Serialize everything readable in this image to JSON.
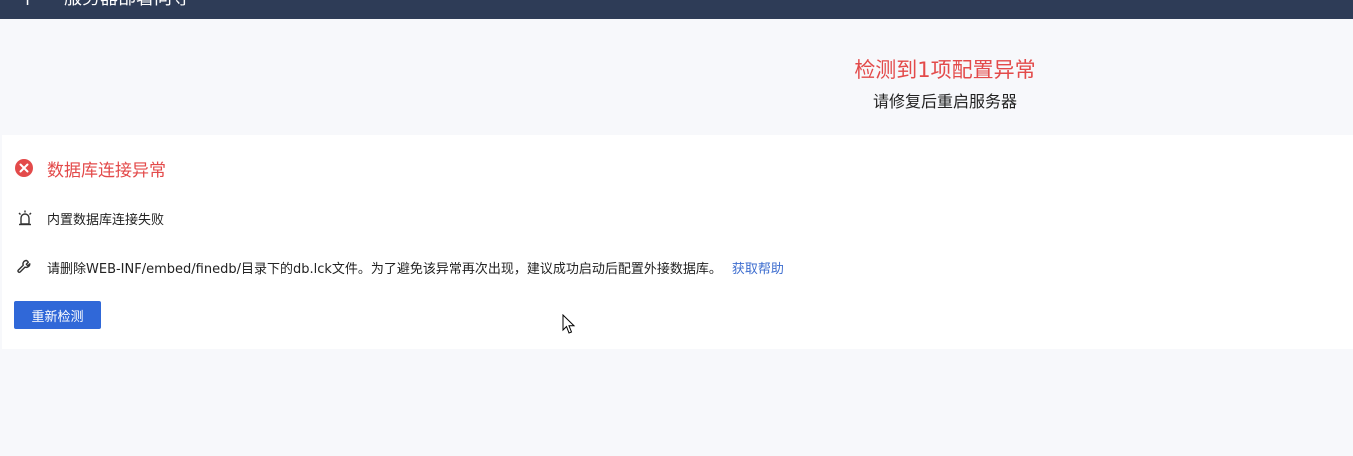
{
  "header": {
    "back_icon": "plus-icon",
    "title": "服务器部署向导"
  },
  "summary": {
    "headline": "检测到1项配置异常",
    "subtext": "请修复后重启服务器"
  },
  "issue": {
    "icon": "error-circle-icon",
    "title": "数据库连接异常",
    "detail_icon": "alarm-icon",
    "detail": "内置数据库连接失败",
    "fix_icon": "wrench-icon",
    "fix": "请删除WEB-INF/embed/finedb/目录下的db.lck文件。为了避免该异常再次出现，建议成功启动后配置外接数据库。",
    "help_link": "获取帮助"
  },
  "actions": {
    "recheck_label": "重新检测"
  },
  "colors": {
    "header_bg": "#2e3c57",
    "error": "#e34a4a",
    "link": "#3d6dcf",
    "button": "#3068d8"
  }
}
